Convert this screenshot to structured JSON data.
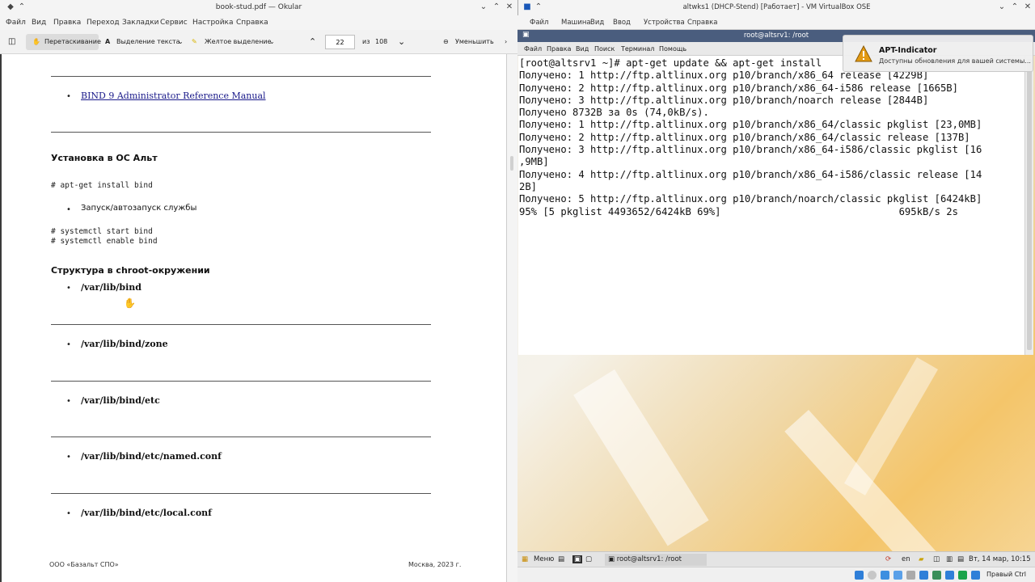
{
  "okular": {
    "title": "book-stud.pdf — Okular",
    "menu": [
      "Файл",
      "Вид",
      "Правка",
      "Переход",
      "Закладки",
      "Сервис",
      "Настройка",
      "Справка"
    ],
    "toolbar": {
      "drag": "Перетаскивание",
      "select_text": "Выделение текста",
      "highlight": "Желтое выделение",
      "page_value": "22",
      "of_label": "из",
      "page_total": "108",
      "zoom_out": "Уменьшить"
    },
    "doc": {
      "link_bind": "BIND 9 Administrator Reference Manual",
      "heading_install": "Установка в ОС Альт",
      "code_install": "# apt-get install bind",
      "item_autostart": "Запуск/автозапуск службы",
      "code_systemctl": "# systemctl start bind\n# systemctl enable bind",
      "heading_chroot": "Структура в chroot-окружении",
      "paths": [
        "/var/lib/bind",
        "/var/lib/bind/zone",
        "/var/lib/bind/etc",
        "/var/lib/bind/etc/named.conf",
        "/var/lib/bind/etc/local.conf"
      ],
      "footer_left": "ООО «Базальт СПО»",
      "footer_right": "Москва, 2023 г."
    },
    "bullet_char": "•"
  },
  "vbox": {
    "title": "altwks1 (DHCP-Stend) [Работает] - VM VirtualBox OSE",
    "menu": [
      "Файл",
      "Машина",
      "Вид",
      "Ввод",
      "Устройства",
      "Справка"
    ],
    "terminal": {
      "title": "root@altsrv1: /root",
      "menu": [
        "Файл",
        "Правка",
        "Вид",
        "Поиск",
        "Терминал",
        "Помощь"
      ],
      "lines": [
        "[root@altsrv1 ~]# apt-get update && apt-get install",
        "Получено: 1 http://ftp.altlinux.org p10/branch/x86_64 release [4229B]",
        "Получено: 2 http://ftp.altlinux.org p10/branch/x86_64-i586 release [1665B]",
        "Получено: 3 http://ftp.altlinux.org p10/branch/noarch release [2844B]",
        "Получено 8732B за 0s (74,0kB/s).",
        "Получено: 1 http://ftp.altlinux.org p10/branch/x86_64/classic pkglist [23,0MB]",
        "Получено: 2 http://ftp.altlinux.org p10/branch/x86_64/classic release [137B]",
        "Получено: 3 http://ftp.altlinux.org p10/branch/x86_64-i586/classic pkglist [16",
        ",9MB]",
        "Получено: 4 http://ftp.altlinux.org p10/branch/x86_64-i586/classic release [14",
        "2B]",
        "Получено: 5 http://ftp.altlinux.org p10/branch/noarch/classic pkglist [6424kB]",
        "95% [5 pkglist 4493652/6424kB 69%]                              695kB/s 2s"
      ]
    },
    "notification": {
      "title": "APT-Indicator",
      "message": "Доступны обновления для вашей системы..."
    },
    "taskbar": {
      "menu_label": "Меню",
      "task_label": "root@altsrv1: /root",
      "lang": "en",
      "clock": "Вт, 14 мар, 10:15"
    },
    "status": {
      "host_key": "Правый Ctrl"
    }
  }
}
